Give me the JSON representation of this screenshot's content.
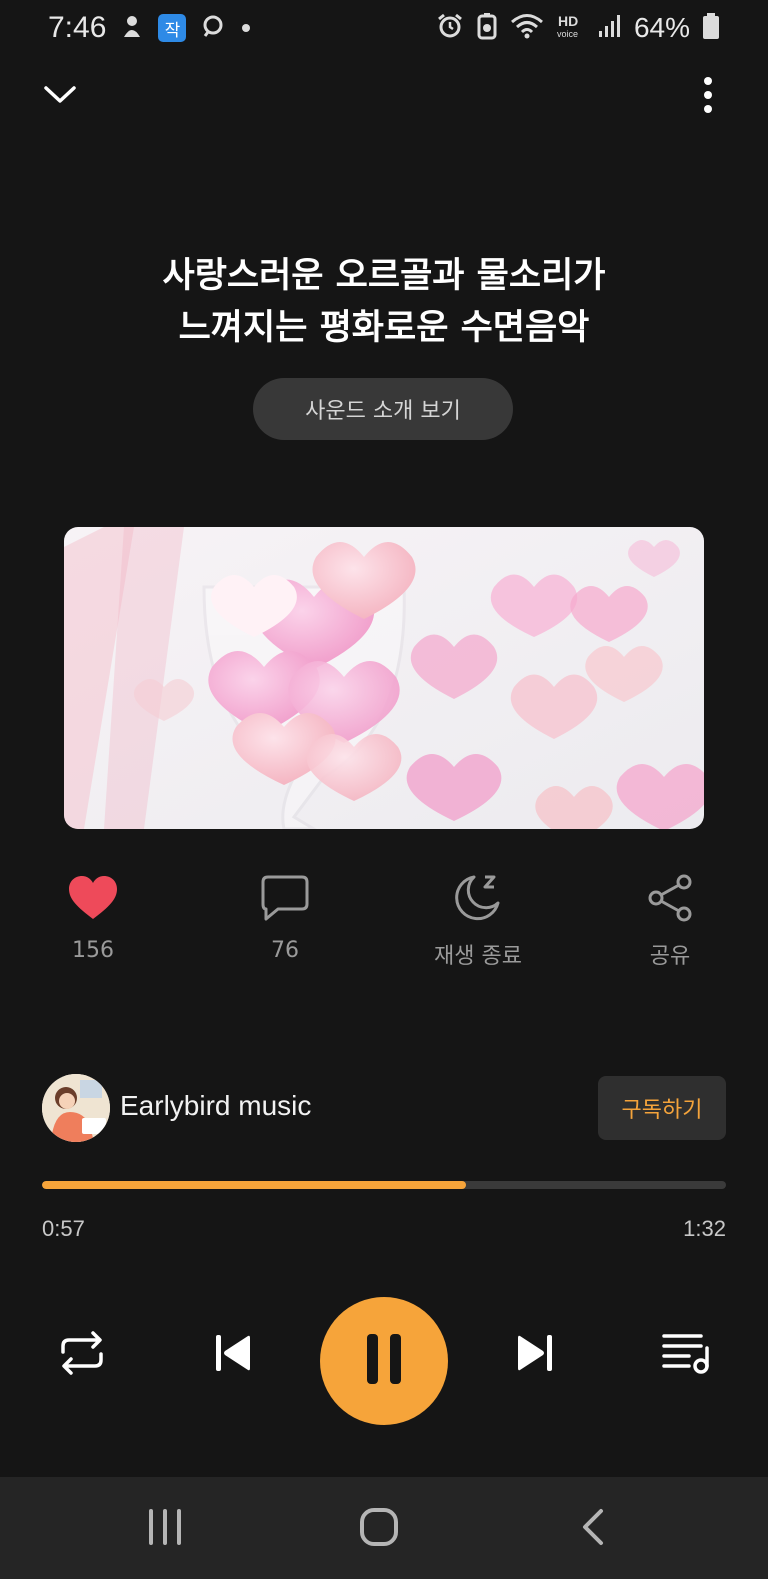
{
  "status_bar": {
    "time": "7:46",
    "app_badge": "작",
    "battery": "64%",
    "icons": [
      "notification-icon",
      "app-badge-icon",
      "search-app-icon",
      "dot-icon",
      "alarm-icon",
      "battery-saver-icon",
      "wifi-icon",
      "hd-voice-icon",
      "signal-icon",
      "battery-icon"
    ]
  },
  "header": {
    "collapse_icon": "chevron-down-icon",
    "menu_icon": "more-vertical-icon"
  },
  "track": {
    "title_line1": "사랑스러운 오르골과 물소리가",
    "title_line2": "느껴지는 평화로운 수면음악",
    "intro_button": "사운드 소개 보기",
    "artwork": "pink-hearts-in-glass-image"
  },
  "actions": [
    {
      "icon": "heart-icon",
      "label": "156",
      "active": true
    },
    {
      "icon": "comment-icon",
      "label": "76"
    },
    {
      "icon": "sleep-timer-icon",
      "label": "재생 종료"
    },
    {
      "icon": "share-icon",
      "label": "공유"
    }
  ],
  "channel": {
    "name": "Earlybird music",
    "subscribe_label": "구독하기"
  },
  "player": {
    "progress": 0.62,
    "elapsed": "0:57",
    "duration": "1:32",
    "controls": [
      "repeat-icon",
      "previous-icon",
      "pause-icon",
      "next-icon",
      "playlist-icon"
    ]
  },
  "colors": {
    "accent": "#f6a43a",
    "heart": "#ee4a5a",
    "background": "#151515"
  },
  "nav_bar": [
    "recent-apps-icon",
    "home-icon",
    "back-icon"
  ]
}
